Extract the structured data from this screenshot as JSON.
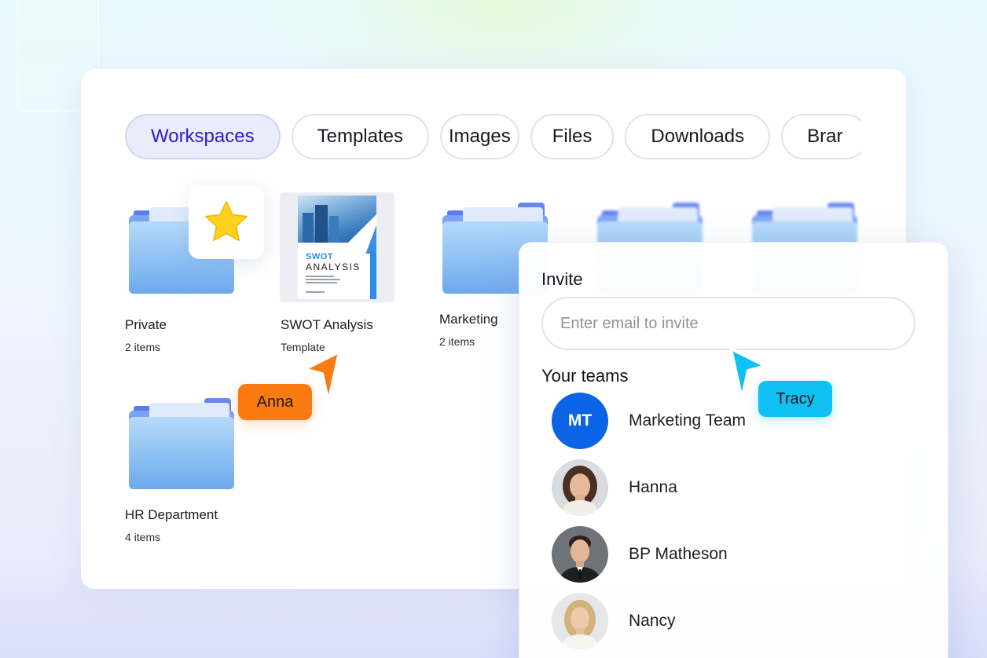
{
  "tabs": [
    {
      "label": "Workspaces",
      "active": true
    },
    {
      "label": "Templates",
      "active": false
    },
    {
      "label": "Images",
      "active": false
    },
    {
      "label": "Files",
      "active": false
    },
    {
      "label": "Downloads",
      "active": false
    },
    {
      "label": "Brar",
      "active": false
    }
  ],
  "items": {
    "private": {
      "name": "Private",
      "sub": "2 items",
      "icon": "folder-icon",
      "badge_icon": "star-icon"
    },
    "swot": {
      "name": "SWOT Analysis",
      "sub": "Template",
      "thumb_title": "SWOT",
      "thumb_subtitle": "ANALYSIS"
    },
    "marketing": {
      "name": "Marketing",
      "sub": "2 items",
      "icon": "folder-icon"
    },
    "hr": {
      "name": "HR Department",
      "sub": "4 items",
      "icon": "folder-icon"
    }
  },
  "cursors": {
    "anna": {
      "label": "Anna",
      "color": "#fb7a12"
    },
    "tracy": {
      "label": "Tracy",
      "color": "#10c0f5"
    }
  },
  "invite": {
    "title": "Invite",
    "placeholder": "Enter email to invite",
    "teams_title": "Your teams",
    "members": [
      {
        "initials": "MT",
        "name": "Marketing Team",
        "avatar_color": "#0b63e6"
      },
      {
        "name": "Hanna"
      },
      {
        "name": "BP Matheson"
      },
      {
        "name": "Nancy"
      }
    ]
  },
  "colors": {
    "accent": "#3318c4",
    "active_tab_bg": "#e9edfb",
    "star": "#ffd21f"
  }
}
